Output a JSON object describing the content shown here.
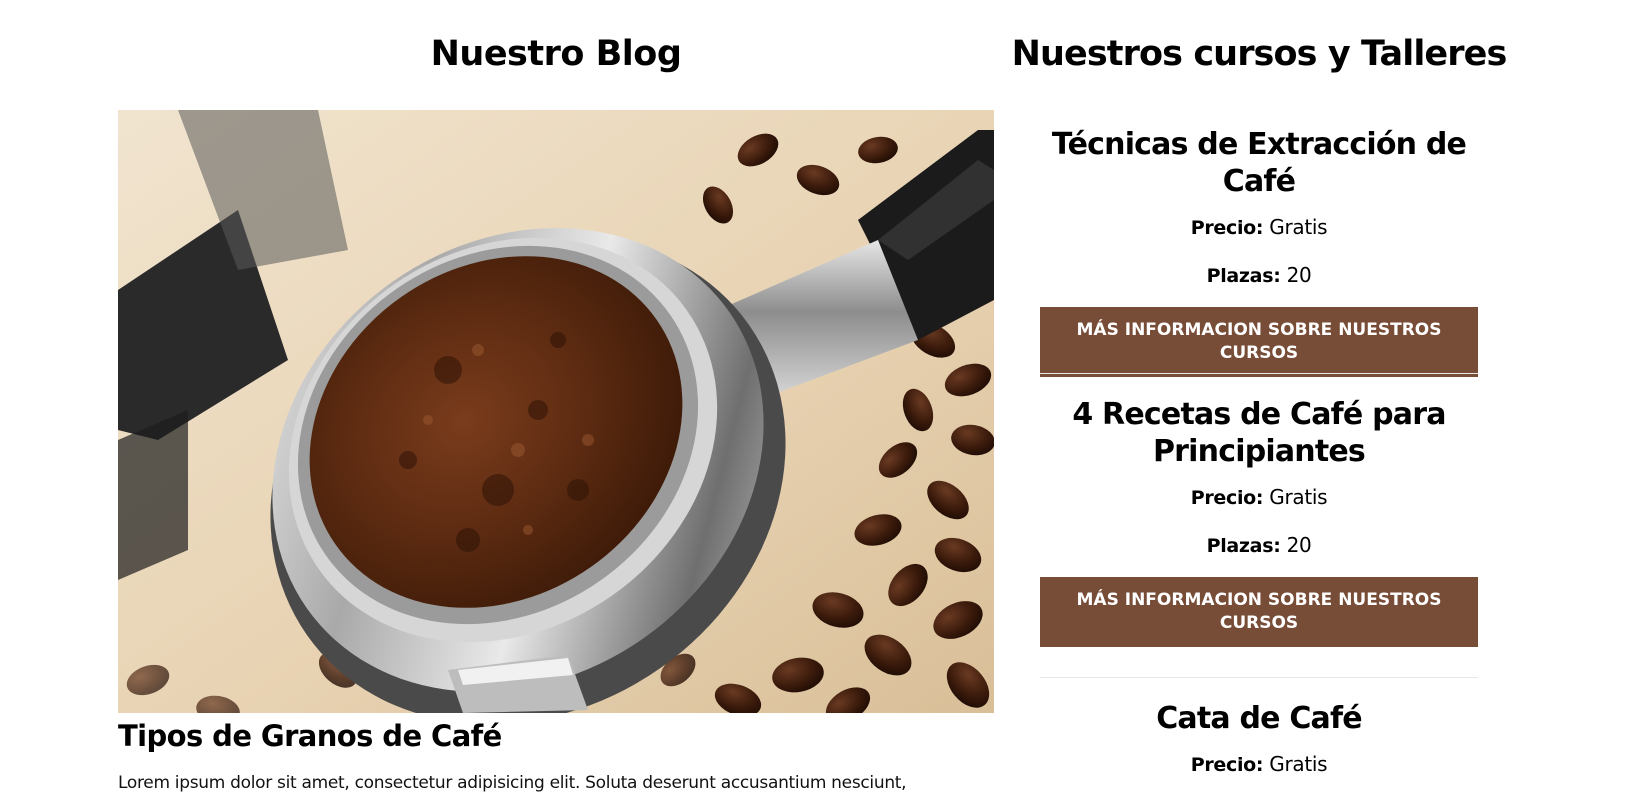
{
  "blog": {
    "heading": "Nuestro Blog",
    "image_icon": "coffee-portafilter-photo",
    "post": {
      "title": "Tipos de Granos de Café",
      "excerpt": "Lorem ipsum dolor sit amet, consectetur adipisicing elit. Soluta deserunt accusantium nesciunt,"
    }
  },
  "courses": {
    "heading": "Nuestros cursos y Talleres",
    "items": [
      {
        "title": "Técnicas de Extracción de Café",
        "price_label": "Precio:",
        "price_value": "Gratis",
        "seats_label": "Plazas:",
        "seats_value": "20",
        "button_label": "Más Informacion sobre nuestros cursos"
      },
      {
        "title": "4 Recetas de Café para Principiantes",
        "price_label": "Precio:",
        "price_value": "Gratis",
        "seats_label": "Plazas:",
        "seats_value": "20",
        "button_label": "Más Informacion sobre nuestros cursos"
      },
      {
        "title": "Cata de Café",
        "price_label": "Precio:",
        "price_value": "Gratis"
      }
    ]
  },
  "colors": {
    "button_background": "#784d38",
    "button_text": "#ffffff",
    "divider": "#e6e6e6"
  }
}
